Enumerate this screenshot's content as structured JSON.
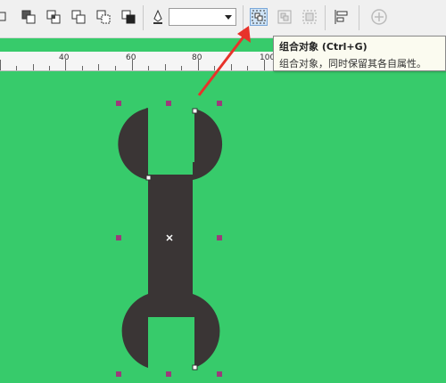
{
  "toolbar": {
    "icons": [
      "shaping-icon",
      "back-minus-front-icon",
      "intersect-icon",
      "simplify-icon",
      "front-minus-back-icon",
      "boundary-icon",
      "outline-pen-icon",
      "group-objects-icon",
      "ungroup-objects-icon",
      "ungroup-all-icon",
      "align-distribute-icon",
      "add-icon"
    ],
    "outline_width_value": ""
  },
  "ruler": {
    "labels": [
      "40",
      "60",
      "80",
      "100"
    ]
  },
  "tooltip": {
    "title": "组合对象 (Ctrl+G)",
    "description": "组合对象，同时保留其各自属性。"
  },
  "colors": {
    "canvas": "#37cb6b",
    "object": "#3a3535",
    "handle": "#9b3b7a",
    "arrow": "#e8322a",
    "toolbar": "#f0f0f0"
  }
}
